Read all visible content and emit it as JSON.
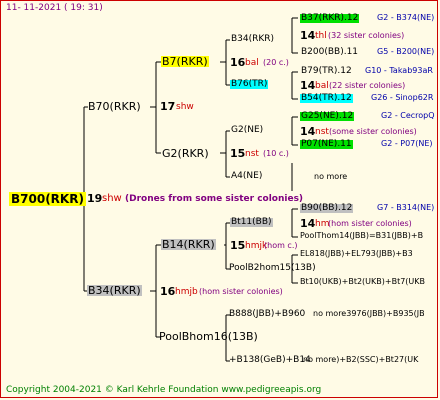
{
  "header": {
    "date": "11- 11-2021 ( 19: 31)"
  },
  "footer": {
    "copyright": "Copyright 2004-2021 © Karl Kehrle Foundation    www.pedigreeapis.org"
  },
  "root": {
    "name": "B700(RKR)",
    "generation": "19",
    "mark": "shw",
    "note": "(Drones from some sister colonies)"
  },
  "gen1": {
    "top": {
      "name": "B70(RKR)",
      "generation": "17",
      "mark": "shw"
    },
    "bottom": {
      "name": "B34(RKR)",
      "generation": "16",
      "mark": "hmjb",
      "note": "(hom sister colonies)"
    }
  },
  "gen2": {
    "a": {
      "name": "B7(RKR)",
      "generation": "16",
      "mark": "bal",
      "note": "(20 c.)"
    },
    "b": {
      "name": "G2(RKR)",
      "generation": "15",
      "mark": "nst",
      "note": "(10 c.)"
    },
    "c": {
      "name": "B14(RKR)",
      "generation": "15",
      "mark": "hmjk",
      "note": "(hom c.)"
    },
    "d": {
      "name": "PoolBhom16(13B)",
      "generation": "",
      "mark": "",
      "note": ""
    }
  },
  "gen3": {
    "a1": {
      "name": "B34(RKR)"
    },
    "a2": {
      "name": "B76(TR)"
    },
    "b1": {
      "name": "G2(NE)"
    },
    "b2": {
      "name": "A4(NE)"
    },
    "c1": {
      "name": "Bt11(BB)"
    },
    "c2": {
      "name": "PoolB2hom15(13B)"
    },
    "d1": {
      "name": "B888(JBB)+B960"
    },
    "d2": {
      "name": "+B138(GeB)+B14"
    }
  },
  "gen4": {
    "r1": {
      "name": "B37(RKR).12",
      "id": "G2 - B374(NE)"
    },
    "r2": {
      "generation": "14",
      "mark": "thl",
      "note": "(32 sister colonies)"
    },
    "r3": {
      "name": "B200(BB).11",
      "id": "G5 - B200(NE)"
    },
    "r4": {
      "name": "B79(TR).12",
      "id": "G10 - Takab93aR"
    },
    "r5": {
      "generation": "14",
      "mark": "bal",
      "note": "(22 sister colonies)"
    },
    "r6": {
      "name": "B54(TR).12",
      "id": "G26 - Sinop62R"
    },
    "r7": {
      "name": "G25(NE).12",
      "id": "G2 - CecropQ"
    },
    "r8": {
      "generation": "14",
      "mark": "nst",
      "note": "(some sister colonies)"
    },
    "r9": {
      "name": "P07(NE).11",
      "id": "G2 - P07(NE)"
    },
    "r10": {
      "text": "no more"
    },
    "r11": {
      "name": "B90(BB).12",
      "id": "G7 - B314(NE)"
    },
    "r12": {
      "generation": "14",
      "mark": "hm",
      "note": "(hom sister colonies)"
    },
    "r13": {
      "name": "PoolThom14(JBB)=B31(JBB)+B"
    },
    "r14": {
      "name": "EL818(JBB)+EL793(JBB)+B3"
    },
    "r15": {
      "name": "Bt10(UKB)+Bt2(UKB)+Bt7(UKB"
    },
    "r16": {
      "name": "no more3976(JBB)+B935(JB"
    },
    "r17": {
      "name": "no more)+B2(SSC)+Bt27(UK"
    }
  }
}
